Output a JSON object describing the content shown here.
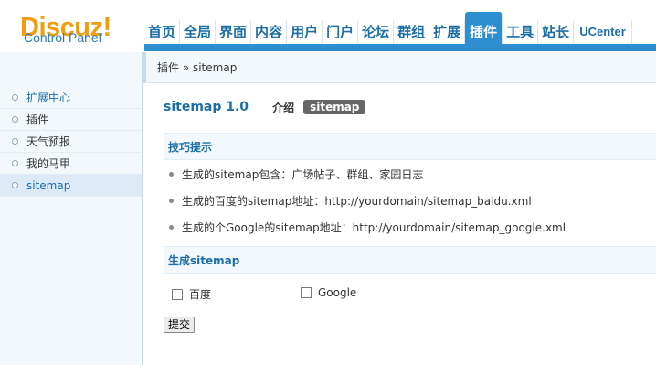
{
  "header": {
    "logo_main": "Discuz!",
    "logo_sub": "Control Panel",
    "nav": [
      "首页",
      "全局",
      "界面",
      "内容",
      "用户",
      "门户",
      "论坛",
      "群组",
      "扩展",
      "插件",
      "工具",
      "站长",
      "UCenter"
    ],
    "active_nav": "插件"
  },
  "sidebar": {
    "items": [
      {
        "label": "扩展中心"
      },
      {
        "label": "插件"
      },
      {
        "label": "天气预报"
      },
      {
        "label": "我的马甲"
      },
      {
        "label": "sitemap"
      }
    ],
    "selected": "sitemap"
  },
  "breadcrumb": "插件 » sitemap",
  "plugin": {
    "title": "sitemap 1.0",
    "tab_intro": "介绍",
    "tab_sitemap": "sitemap"
  },
  "tips_section": {
    "heading": "技巧提示",
    "items": [
      "生成的sitemap包含：广场帖子、群组、家园日志",
      "生成的百度的sitemap地址：http://yourdomain/sitemap_baidu.xml",
      "生成的个Google的sitemap地址：http://yourdomain/sitemap_google.xml"
    ]
  },
  "generate_section": {
    "heading": "生成sitemap",
    "options": [
      {
        "label": "百度",
        "checked": false
      },
      {
        "label": "Google",
        "checked": false
      }
    ],
    "submit_label": "提交"
  },
  "colors": {
    "accent_blue": "#2d8fd0",
    "link_blue": "#1c6ea8",
    "logo_orange": "#f39c12",
    "sidebar_bg": "#f2f8fc"
  }
}
